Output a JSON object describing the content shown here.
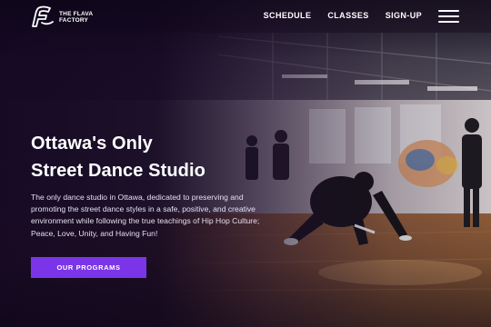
{
  "brand": {
    "name_line1": "THE FLAVA",
    "name_line2": "FACTORY",
    "logo_icon": "flava-factory-logo"
  },
  "nav": {
    "items": [
      {
        "label": "SCHEDULE"
      },
      {
        "label": "CLASSES"
      },
      {
        "label": "SIGN-UP"
      }
    ],
    "menu_icon": "hamburger-menu-icon"
  },
  "hero": {
    "title_line1": "Ottawa's Only",
    "title_line2": "Street Dance Studio",
    "description": "The only dance studio in Ottawa, dedicated to preserving and promoting the street dance styles in a safe, positive, and creative environment while following the true teachings of Hip Hop Culture; Peace, Love, Unity, and Having Fun!",
    "cta_label": "OUR PROGRAMS",
    "image": "dance-studio-breakdancer-photo"
  },
  "colors": {
    "accent": "#7b35e8",
    "background": "#140a22"
  }
}
